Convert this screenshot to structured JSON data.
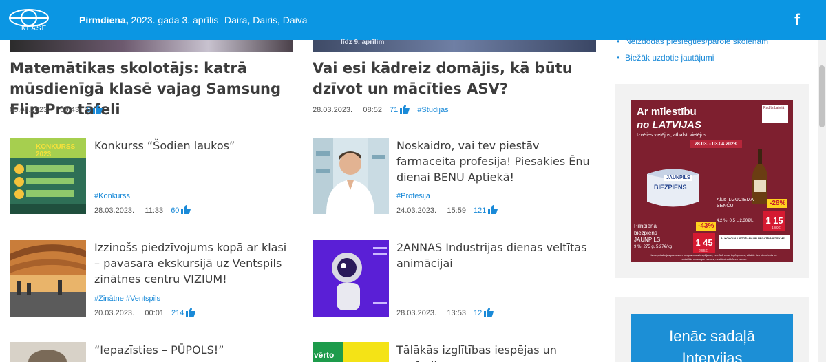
{
  "header": {
    "logo_text": "KLASE",
    "day": "Pirmdiena,",
    "date": " 2023. gada 3. aprīlis",
    "namedays": "Daira, Dairis, Daiva",
    "social": "f"
  },
  "top_strip": {
    "caption": "līdz 9. aprīlim"
  },
  "featured": [
    {
      "title": "Matemātikas skolotājs: katrā mūsdienīgā klasē vajag Samsung Flip Pro tāfeli",
      "date": "03.04.2023.",
      "time": "09:43",
      "likes": "5",
      "tag": ""
    },
    {
      "title": "Vai esi kādreiz domājis, kā būtu dzīvot un mācīties ASV?",
      "date": "28.03.2023.",
      "time": "08:52",
      "likes": "71",
      "tag": "#Studijas"
    }
  ],
  "articles": [
    {
      "title": "Konkurss “Šodien laukos”",
      "tags": "#Konkurss",
      "date": "28.03.2023.",
      "time": "11:33",
      "likes": "60",
      "thumb_text": "KONKURSS 2023"
    },
    {
      "title": "Noskaidro, vai tev piestāv farmaceita profesija! Piesakies Ēnu dienai BENU Aptiekā!",
      "tags": "#Profesija",
      "date": "24.03.2023.",
      "time": "15:59",
      "likes": "121",
      "thumb_text": ""
    },
    {
      "title": "Izzinošs piedzīvojums kopā ar klasi – pavasara ekskursijā uz Ventspils zinātnes centru VIZIUM!",
      "tags": "#Zinātne #Ventspils",
      "date": "20.03.2023.",
      "time": "00:01",
      "likes": "214",
      "thumb_text": ""
    },
    {
      "title": "2ANNAS Industrijas dienas veltītas animācijai",
      "tags": "",
      "date": "28.03.2023.",
      "time": "13:53",
      "likes": "12",
      "thumb_text": ""
    },
    {
      "title": "“Iepazīsties – PŪPOLS!”",
      "tags": "",
      "date": "",
      "time": "",
      "likes": "",
      "thumb_text": ""
    },
    {
      "title": "Tālākās izglītības iespējas un profesiju",
      "tags": "",
      "date": "",
      "time": "",
      "likes": "",
      "thumb_text": "vērto"
    }
  ],
  "sidebar": {
    "links": [
      "Neizdodas pieslēgties/parole skolēnam",
      "Biežāk uzdotie jautājumi"
    ],
    "ad": {
      "headline1": "Ar mīlestību",
      "headline2": "no LATVIJAS",
      "sub": "Izvēlies vietējos, atbalsti vietējos",
      "dates": "28.03. - 03.04.2023.",
      "brand": "Radīts Latvijā",
      "product1_name": "Pilnpiena biezpiens JAUNPILS",
      "product1_detail": "9 %, 275 g, 5,27€/kg",
      "product1_discount": "-43%",
      "product1_price": "1 45",
      "product1_old": "2,55€",
      "product2_name": "Alus ILGUCIEMA SENČU",
      "product2_detail": "4,2 %, 0,5 L 2,30€/L",
      "product2_discount": "-28%",
      "product2_price": "1 15",
      "product2_old": "1,59€",
      "package_label1": "JAUNPILS",
      "package_label2": "BIEZPIENS",
      "warning": "ALKOHOLA LIETOŠANAI IR NEGATĪVA IETEKME.",
      "footnote": "Izmeņot akcijas preces un programmas iespējamo, zemākā cena tirgū preces, atlaide tiek piemērota no norādītās cenas pie preces, neattiecinot bāzes cenas."
    },
    "ad2": {
      "line1": "Ienāc sadaļā",
      "line2": "Intervijas"
    }
  }
}
